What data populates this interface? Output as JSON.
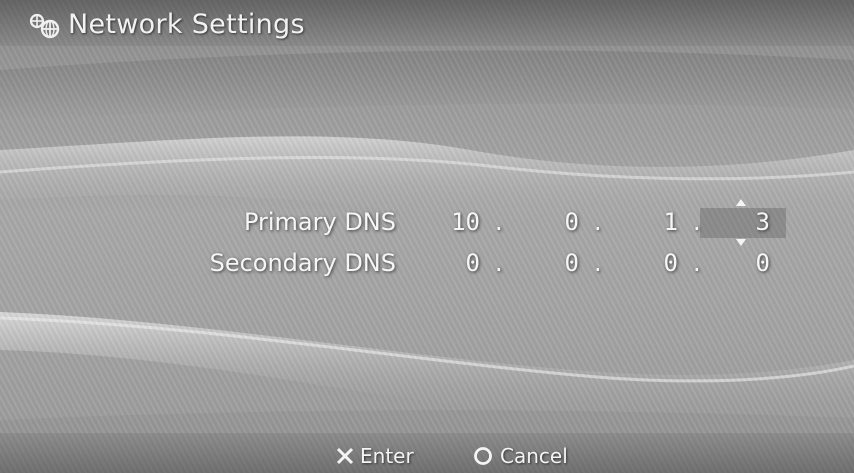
{
  "window": {
    "title": "Network Settings",
    "icon": "network-globe-icon"
  },
  "dns": {
    "primary": {
      "label": "Primary DNS",
      "octets": [
        "10",
        "0",
        "1",
        "3"
      ]
    },
    "secondary": {
      "label": "Secondary DNS",
      "octets": [
        "0",
        "0",
        "0",
        "0"
      ]
    },
    "separator": ".",
    "selected_field": "primary.octet4"
  },
  "footer": {
    "enter": {
      "icon": "cross-button-icon",
      "label": "Enter"
    },
    "cancel": {
      "icon": "circle-button-icon",
      "label": "Cancel"
    }
  },
  "colors": {
    "text": "#f6f6f6",
    "background": "#a4a4a4"
  }
}
